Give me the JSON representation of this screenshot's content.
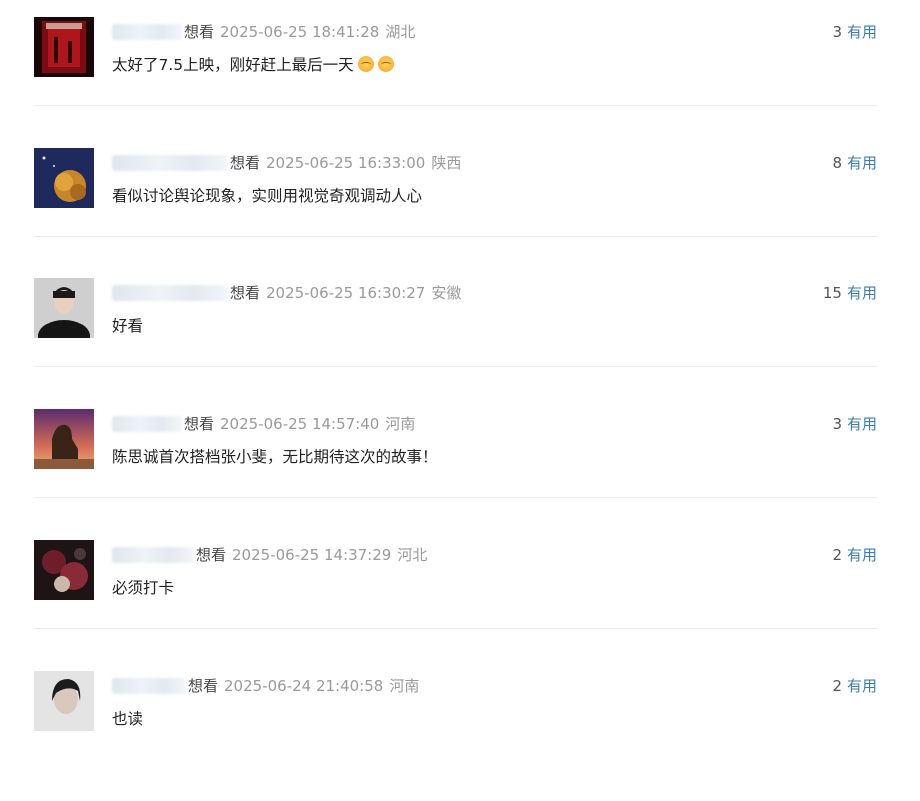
{
  "comments": [
    {
      "status": "想看",
      "time": "2025-06-25 18:41:28",
      "location": "湖北",
      "votes": "3",
      "useful": "有用",
      "text": "太好了7.5上映，刚好赶上最后一天",
      "emoji": [
        "relieved-face",
        "relieved-face"
      ]
    },
    {
      "status": "想看",
      "time": "2025-06-25 16:33:00",
      "location": "陕西",
      "votes": "8",
      "useful": "有用",
      "text": "看似讨论舆论现象，实则用视觉奇观调动人心"
    },
    {
      "status": "想看",
      "time": "2025-06-25 16:30:27",
      "location": "安徽",
      "votes": "15",
      "useful": "有用",
      "text": "好看"
    },
    {
      "status": "想看",
      "time": "2025-06-25 14:57:40",
      "location": "河南",
      "votes": "3",
      "useful": "有用",
      "text": "陈思诚首次搭档张小斐，无比期待这次的故事！"
    },
    {
      "status": "想看",
      "time": "2025-06-25 14:37:29",
      "location": "河北",
      "votes": "2",
      "useful": "有用",
      "text": "必须打卡"
    },
    {
      "status": "想看",
      "time": "2025-06-24 21:40:58",
      "location": "河南",
      "votes": "2",
      "useful": "有用",
      "text": "也读"
    }
  ]
}
